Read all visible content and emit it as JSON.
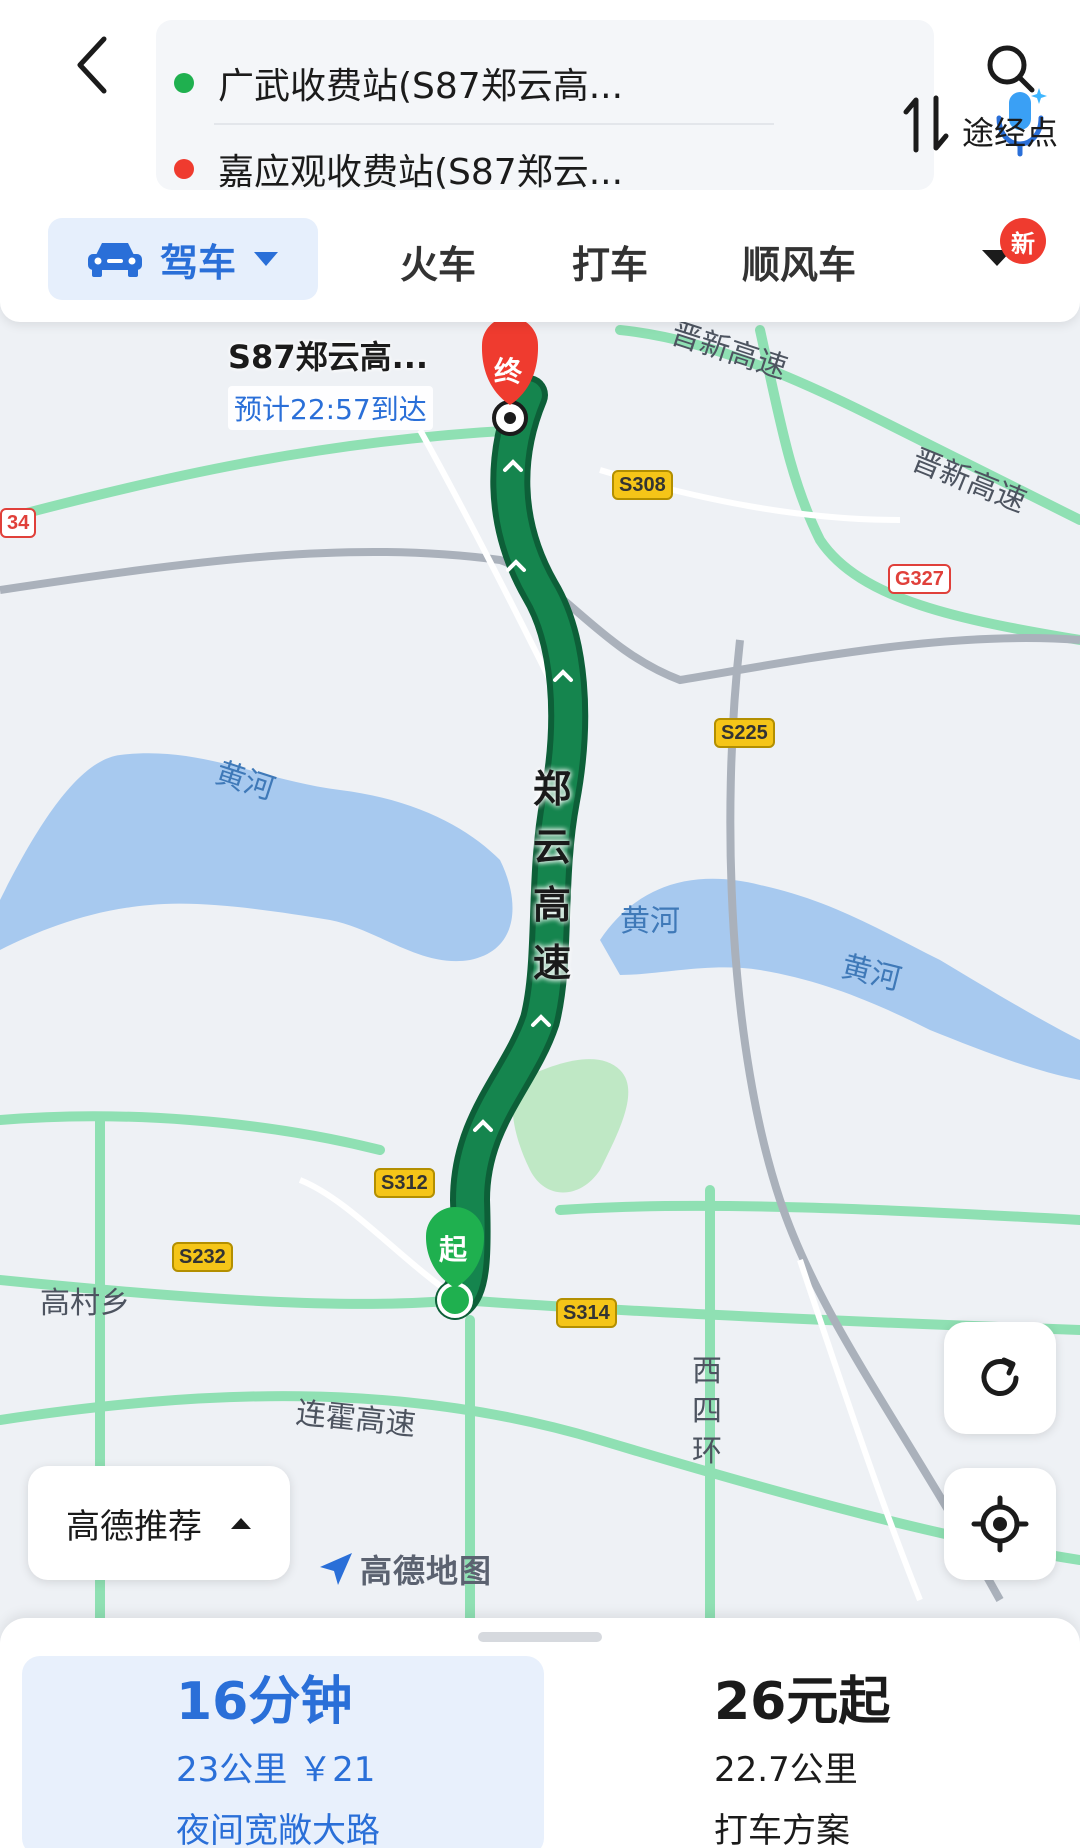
{
  "route": {
    "from": "广武收费站(S87郑云高...",
    "to": "嘉应观收费站(S87郑云...",
    "waypoint_label": "途经点"
  },
  "modes": {
    "active": "驾车",
    "tabs": [
      "火车",
      "打车",
      "顺风车"
    ],
    "new_badge": "新"
  },
  "map": {
    "destination_name": "S87郑云高...",
    "eta": "预计22:57到达",
    "end_marker": "终",
    "start_marker": "起",
    "route_name": "郑云高速",
    "road_badges": [
      "S308",
      "G327",
      "S225",
      "S312",
      "S232",
      "S314",
      "34"
    ],
    "labels": {
      "jinxin_1": "晋新高速",
      "jinxin_2": "晋新高速",
      "river_1": "黄河",
      "river_2": "黄河",
      "river_3": "黄河",
      "gaocun": "高村乡",
      "lianhuo": "连霍高速",
      "xisihuan": "西四环"
    },
    "recommend_label": "高德推荐",
    "logo_text": "高德地图"
  },
  "plans": {
    "primary": {
      "time": "16分钟",
      "detail": "23公里 ￥21",
      "tag": "夜间宽敞大路"
    },
    "taxi": {
      "price": "26元起",
      "distance": "22.7公里",
      "tag": "打车方案"
    }
  },
  "colors": {
    "accent": "#2a6fd8",
    "route": "#0f7a45",
    "start_dot": "#1fb04f",
    "end_dot": "#ef3b2f"
  }
}
